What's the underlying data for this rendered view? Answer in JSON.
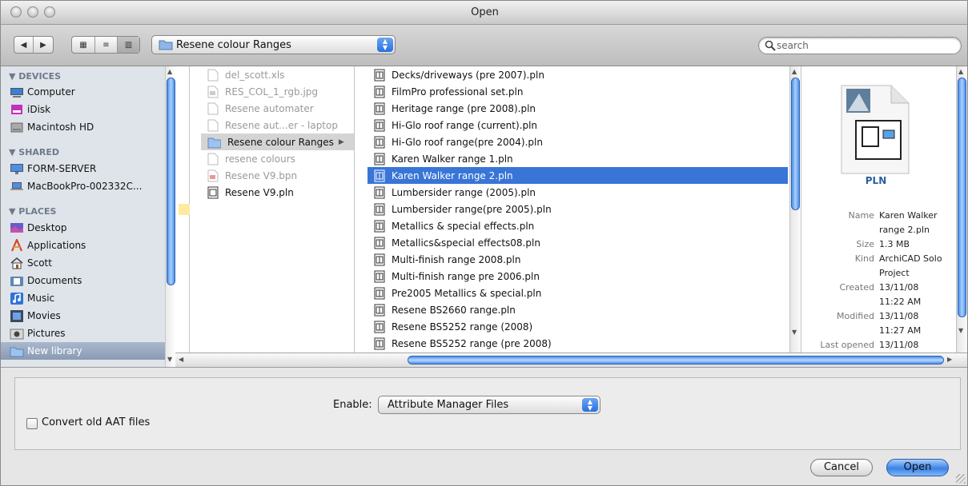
{
  "window": {
    "title": "Open"
  },
  "toolbar": {
    "back_label": "◀",
    "forward_label": "▶",
    "view_icons_label": "▦",
    "view_list_label": "≡",
    "view_columns_label": "▥",
    "location": "Resene colour Ranges",
    "search_placeholder": "search"
  },
  "sidebar": {
    "devices_header": "▼ DEVICES",
    "shared_header": "▼ SHARED",
    "places_header": "▼ PLACES",
    "devices": [
      "Computer",
      "iDisk",
      "Macintosh HD"
    ],
    "shared": [
      "FORM-SERVER",
      "MacBookPro-002332C..."
    ],
    "places": [
      "Desktop",
      "Applications",
      "Scott",
      "Documents",
      "Music",
      "Movies",
      "Pictures",
      "New library"
    ]
  },
  "column1": {
    "items": [
      {
        "name": "del_scott.xls",
        "dim": true
      },
      {
        "name": "RES_COL_1_rgb.jpg",
        "dim": true
      },
      {
        "name": "Resene automater",
        "dim": true
      },
      {
        "name": "Resene aut...er - laptop",
        "dim": true
      },
      {
        "name": "Resene colour Ranges",
        "dim": false,
        "folder": true
      },
      {
        "name": "resene colours",
        "dim": true
      },
      {
        "name": "Resene V9.bpn",
        "dim": true
      },
      {
        "name": "Resene V9.pln",
        "dim": false
      }
    ]
  },
  "column2": {
    "items": [
      "Decks/driveways (pre 2007).pln",
      "FilmPro professional set.pln",
      "Heritage range (pre 2008).pln",
      "Hi-Glo roof range (current).pln",
      "Hi-Glo roof range(pre 2004).pln",
      "Karen Walker range 1.pln",
      "Karen Walker range 2.pln",
      "Lumbersider range (2005).pln",
      "Lumbersider range(pre 2005).pln",
      "Metallics & special effects.pln",
      "Metallics&special effects08.pln",
      "Multi-finish range 2008.pln",
      "Multi-finish range pre 2006.pln",
      "Pre2005 Metallics & special.pln",
      "Resene BS2660 range.pln",
      "Resene BS5252 range (2008)",
      "Resene BS5252 range (pre 2008)"
    ],
    "selected_index": 6
  },
  "preview": {
    "badge": "PLN",
    "name_label": "Name",
    "name_value_1": "Karen Walker",
    "name_value_2": "range 2.pln",
    "size_label": "Size",
    "size_value": "1.3 MB",
    "kind_label": "Kind",
    "kind_value_1": "ArchiCAD Solo",
    "kind_value_2": "Project",
    "created_label": "Created",
    "created_date": "13/11/08",
    "created_time": "11:22 AM",
    "modified_label": "Modified",
    "modified_date": "13/11/08",
    "modified_time": "11:27 AM",
    "opened_label": "Last opened",
    "opened_date": "13/11/08"
  },
  "accessory": {
    "enable_label": "Enable:",
    "enable_value": "Attribute Manager Files",
    "convert_label": "Convert old AAT files",
    "convert_checked": false
  },
  "buttons": {
    "cancel": "Cancel",
    "open": "Open"
  },
  "colors": {
    "selection": "#3875d7",
    "sidebar_bg": "#dfe4ea",
    "accent": "#2a6fe0"
  }
}
